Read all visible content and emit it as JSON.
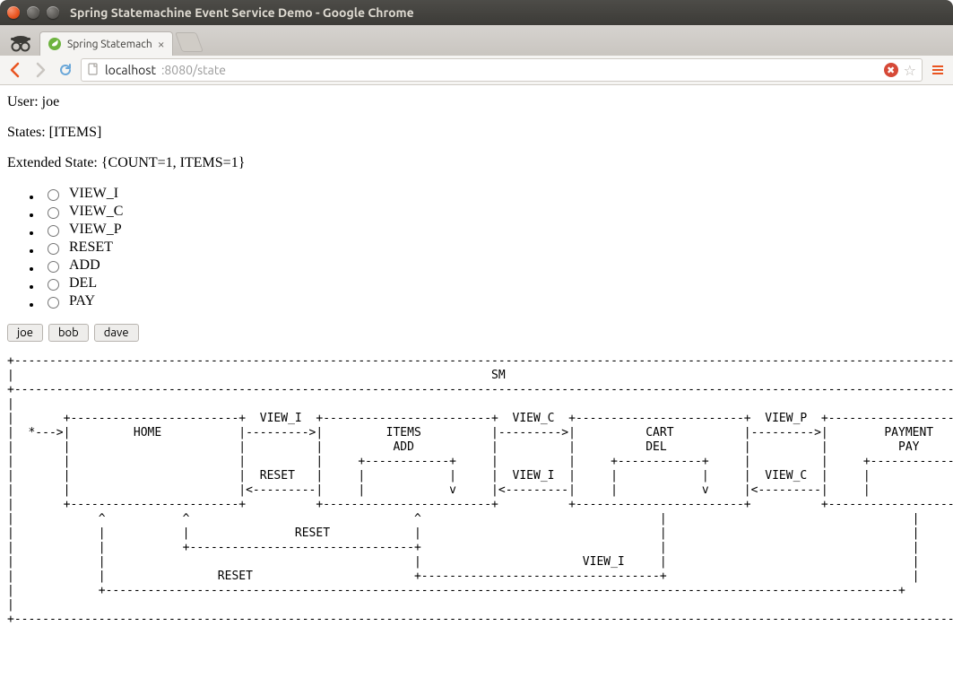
{
  "window": {
    "title": "Spring Statemachine Event Service Demo - Google Chrome"
  },
  "tab": {
    "title": "Spring Statemach",
    "favicon": "spring"
  },
  "address": {
    "host": "localhost",
    "port_path": ":8080/state"
  },
  "content": {
    "user_label": "User: ",
    "user_value": "joe",
    "states_label": "States: ",
    "states_value": "[ITEMS]",
    "ext_state_label": "Extended State: ",
    "ext_state_value": "{COUNT=1, ITEMS=1}",
    "radio_options": [
      "VIEW_I",
      "VIEW_C",
      "VIEW_P",
      "RESET",
      "ADD",
      "DEL",
      "PAY"
    ],
    "user_buttons": [
      "joe",
      "bob",
      "dave"
    ]
  },
  "ascii": "+----------------------------------------------------------------------------------------------------------------------------------------------+\n|                                                                    SM                                                                        |\n+----------------------------------------------------------------------------------------------------------------------------------------------+\n|                                                                                                                                              |\n|       +------------------------+  VIEW_I  +------------------------+  VIEW_C  +------------------------+  VIEW_P  +------------------------+ |\n|  *--->|         HOME           |--------->|         ITEMS          |--------->|          CART          |--------->|        PAYMENT         | |\n|       |                        |          |          ADD           |          |          DEL           |          |          PAY           | |\n|       |                        |          |     +------------+     |          |     +------------+     |          |     +------------+     | |\n|       |                        |  RESET   |     |            |     |  VIEW_I  |     |            |     |  VIEW_C  |     |            |     | |\n|       |                        |<---------|     |            v     |<---------|     |            v     |<---------|     |            v     | |\n|       +------------------------+          +------------------------+          +------------------------+          +------------------------+ |\n|            ^           ^                                ^                                  |                                   |             |\n|            |           |               RESET            |                                  |                                   |             |\n|            |           +--------------------------------+                                  |                                   |             |\n|            |                                            |                       VIEW_I     |                                   |             |\n|            |                RESET                       +----------------------------------+                                   |             |\n|            +-----------------------------------------------------------------------------------------------------------------+             |\n|                                                                                                                                              |\n+----------------------------------------------------------------------------------------------------------------------------------------------+"
}
